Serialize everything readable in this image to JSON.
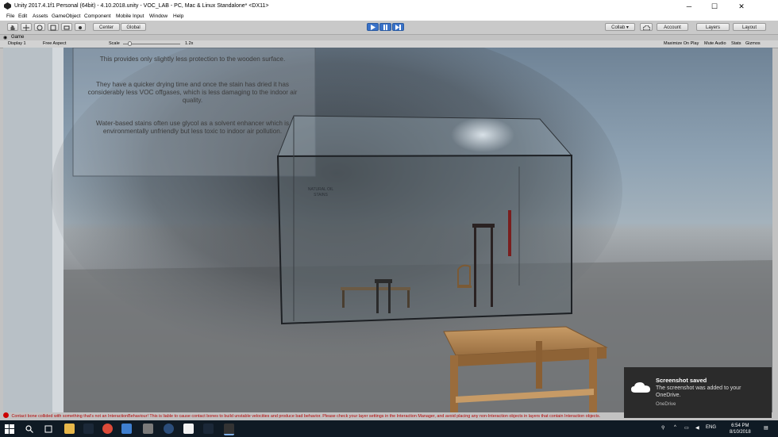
{
  "window": {
    "title": "Unity 2017.4.1f1 Personal (64bit) - 4.10.2018.unity - VOC_LAB - PC, Mac & Linux Standalone* <DX11>",
    "minimize": "─",
    "maximize": "☐",
    "close": "✕"
  },
  "menu": [
    "File",
    "Edit",
    "Assets",
    "GameObject",
    "Component",
    "Mobile Input",
    "Window",
    "Help"
  ],
  "toolbar": {
    "pivot": "Center",
    "space": "Global",
    "collab": "Collab ▾",
    "account": "Account",
    "layers": "Layers",
    "layout": "Layout"
  },
  "game_tab": {
    "label": "Game",
    "display": "Display 1",
    "aspect": "Free Aspect",
    "scale_label": "Scale",
    "scale_value": "1.2x",
    "maximize_on_play": "Maximize On Play",
    "mute_audio": "Mute Audio",
    "stats": "Stats",
    "gizmos": "Gizmos"
  },
  "info_panel": {
    "p1": "This provides only slightly less protection to the wooden surface.",
    "p2": "They have a quicker drying time and once the stain has dried it has considerably less VOC offgases, which is less damaging to the indoor air quality.",
    "p3": "Water-based stains often use glycol as a solvent enhancer which is environmentally unfriendly but less toxic to indoor air pollution."
  },
  "inner_sign": {
    "line1": "NATURAL OIL",
    "line2": "STAINS"
  },
  "status_message": "Contact bone collided with something that's not an InteractionBehaviour! This is liable to cause contact bones to build unstable velocities and produce bad behavior. Please check your layer settings in the Interaction Manager, and avoid placing any non-Interaction objects in layers that contain Interaction objects.",
  "toast": {
    "title": "Screenshot saved",
    "body": "The screenshot was added to your OneDrive.",
    "source": "OneDrive"
  },
  "taskbar": {
    "language": "ENG",
    "time": "6:54 PM",
    "date": "8/10/2018"
  }
}
